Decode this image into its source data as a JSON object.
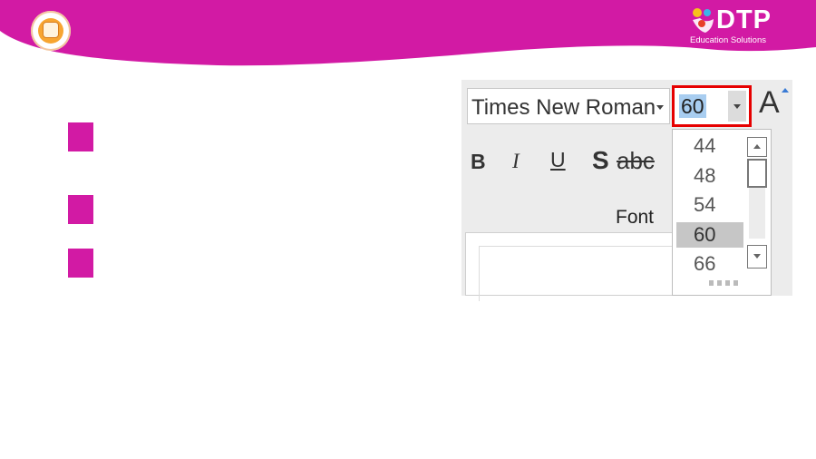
{
  "header": {
    "brand_name": "DTP",
    "brand_sub": "Education Solutions",
    "banner_color": "#d21aa4",
    "logo_icon": "owl-book-logo"
  },
  "font_panel": {
    "font_name": "Times New Roman",
    "font_size": "60",
    "grow_font_label": "A",
    "group_label": "Font",
    "format_buttons": {
      "bold": "B",
      "italic": "I",
      "underline": "U",
      "shadow": "S",
      "strikethrough": "abc"
    },
    "size_options": [
      {
        "label": "44",
        "selected": false
      },
      {
        "label": "48",
        "selected": false
      },
      {
        "label": "54",
        "selected": false
      },
      {
        "label": "60",
        "selected": true
      },
      {
        "label": "66",
        "selected": false
      }
    ],
    "highlight_color": "#e60000"
  }
}
